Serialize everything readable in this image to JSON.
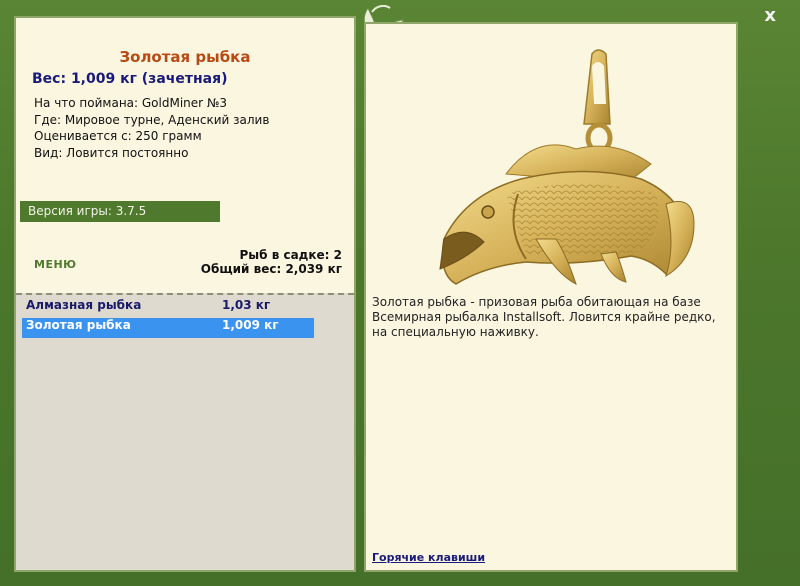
{
  "window": {
    "close_label": "x"
  },
  "fish": {
    "title": "Золотая рыбка",
    "weight_line": "Вес: 1,009 кг (зачетная)",
    "caught_on": "На что поймана: GoldMiner №3",
    "where": "Где: Мировое турне, Аденский залив",
    "rated_from": "Оценивается с: 250 грамм",
    "type": "Вид: Ловится постоянно"
  },
  "version_label": "Версия игры: 3.7.5",
  "menu_label": "меню",
  "stats": {
    "fish_in_keepnet": "Рыб в садке: 2",
    "total_weight": "Общий вес: 2,039 кг"
  },
  "fish_list": [
    {
      "name": "Алмазная рыбка",
      "weight": "1,03 кг",
      "selected": false
    },
    {
      "name": "Золотая рыбка",
      "weight": "1,009 кг",
      "selected": true
    }
  ],
  "description": "Золотая рыбка - призовая рыба обитающая на базе Всемирная рыбалка Installsoft. Ловится крайне редко, на специальную наживку.",
  "hotkeys_label": "Горячие клавиши",
  "colors": {
    "frame_green": "#4e7a2c",
    "panel_cream": "#fbf6e0",
    "selection_blue": "#3b93f0",
    "title_orange": "#b84a14"
  }
}
